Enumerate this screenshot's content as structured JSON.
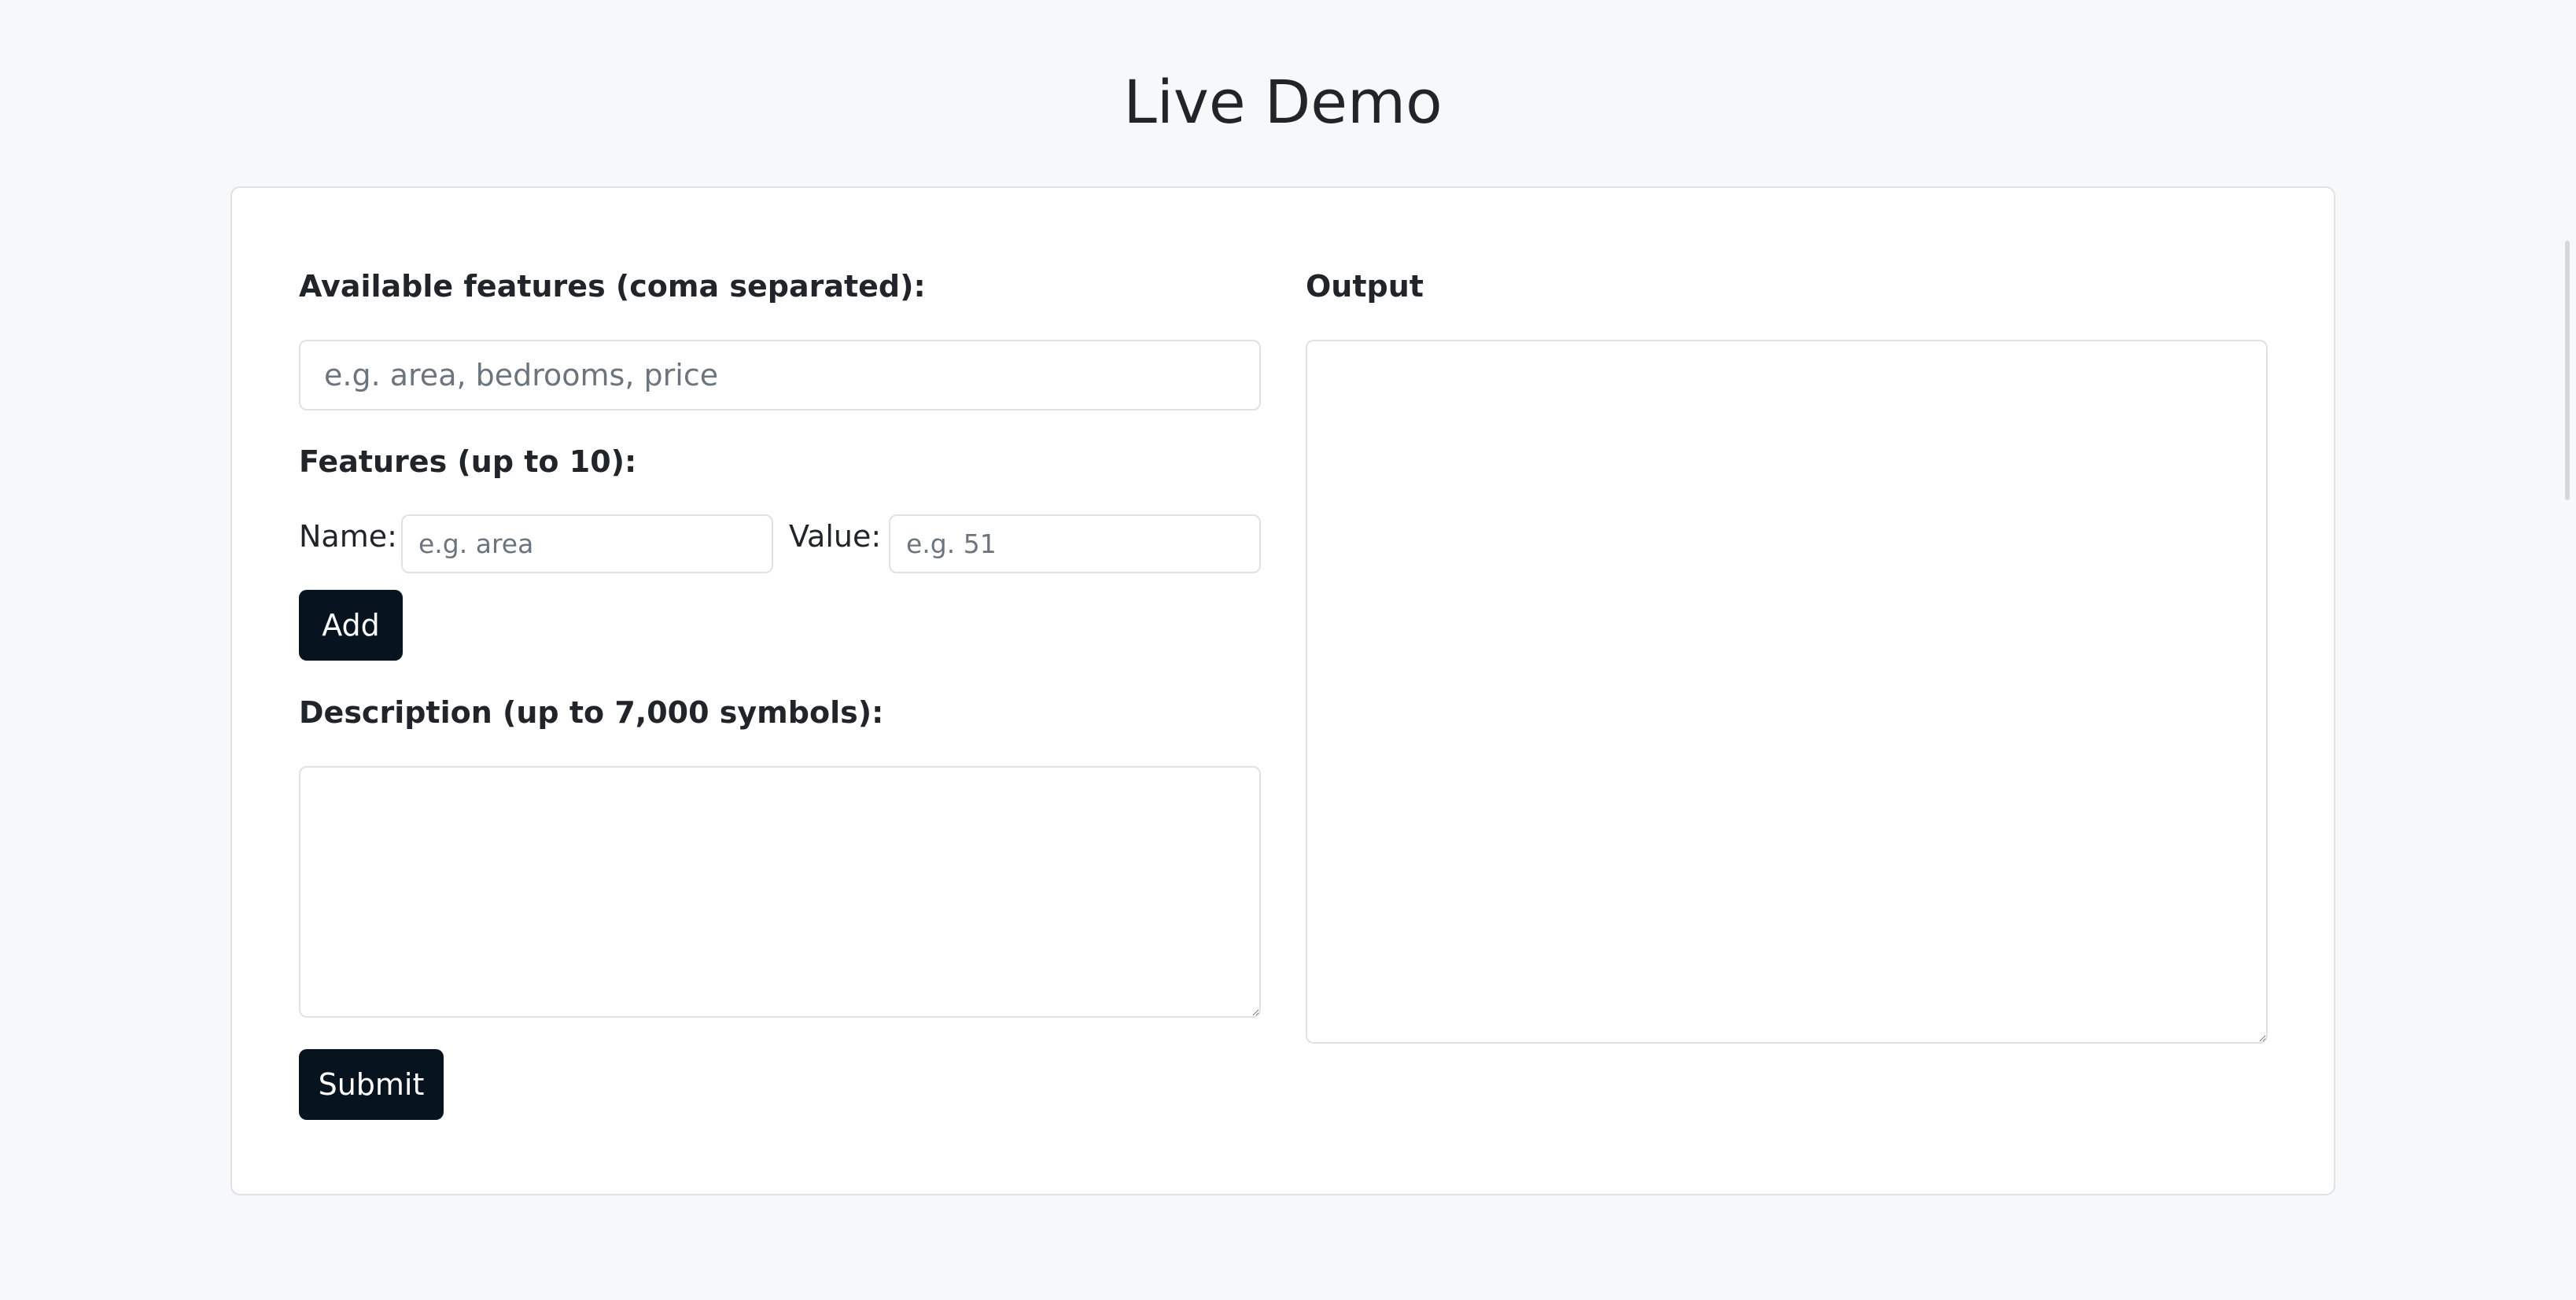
{
  "page": {
    "title": "Live Demo"
  },
  "form": {
    "available_features_label": "Available features (coma separated):",
    "available_features_placeholder": "e.g. area, bedrooms, price",
    "available_features_value": "",
    "features_label": "Features (up to 10):",
    "name_label": "Name:",
    "name_placeholder": "e.g. area",
    "value_label": "Value:",
    "value_placeholder": "e.g. 51",
    "add_button_label": "Add",
    "description_label": "Description (up to 7,000 symbols):",
    "description_value": "",
    "submit_button_label": "Submit"
  },
  "output": {
    "label": "Output",
    "value": ""
  },
  "colors": {
    "background": "#f7f8f9",
    "card": "#ffffff",
    "border": "#dee2e6",
    "button": "#07141f",
    "button_text": "#ffffff",
    "text": "#212529",
    "placeholder": "#6c757d"
  }
}
